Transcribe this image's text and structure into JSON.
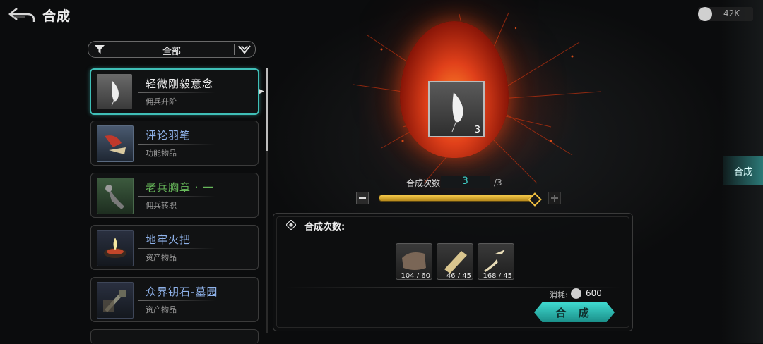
{
  "header": {
    "title": "合成",
    "currency_value": "42K"
  },
  "filter": {
    "label": "全部"
  },
  "list": {
    "items": [
      {
        "name": "轻微刚毅意念",
        "category": "佣兵升阶",
        "name_color": "#ececec"
      },
      {
        "name": "评论羽笔",
        "category": "功能物品",
        "name_color": "#8fb2ea"
      },
      {
        "name": "老兵胸章 · 一",
        "category": "佣兵转职",
        "name_color": "#67b85a"
      },
      {
        "name": "地牢火把",
        "category": "资产物品",
        "name_color": "#8fb2ea"
      },
      {
        "name": "众界钥石-墓园",
        "category": "资产物品",
        "name_color": "#8fb2ea"
      }
    ]
  },
  "preview": {
    "item_count": "3"
  },
  "craft_count": {
    "label": "合成次数:",
    "value": "3",
    "max": "/3",
    "slider_fraction": 1.0
  },
  "panel": {
    "title": "合成次数:",
    "materials": [
      {
        "qty": "104 / 60"
      },
      {
        "qty": "46 / 45"
      },
      {
        "qty": "168 / 45"
      }
    ],
    "cost_label": "消耗:",
    "cost_value": "600",
    "craft_button": "合 成"
  },
  "side_tab": {
    "label": "合成"
  },
  "colors": {
    "accent": "#3fbfb7",
    "slider": "#f0c040"
  }
}
